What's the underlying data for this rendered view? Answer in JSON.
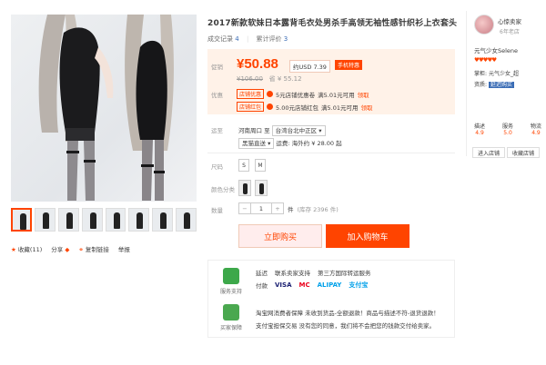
{
  "product": {
    "title": "2017新款软妹日本露背毛衣处男杀手高领无袖性感针织衫上衣套头",
    "stats": [
      {
        "label": "成交记录",
        "value": "4"
      },
      {
        "label": "累计评价",
        "value": "3"
      }
    ]
  },
  "price_box": {
    "price_label": "促销",
    "price": "¥50.88",
    "usd": "约USD 7.39",
    "mobile_badge": "手机特惠",
    "original_price": "¥106.00",
    "original_note": "省 ¥ 55.12",
    "promo_label": "优惠",
    "promos": [
      {
        "tag": "店铺优惠",
        "text": "5元店铺优惠卷",
        "detail": "满5.01元可用",
        "link": "领取"
      },
      {
        "tag": "店铺红包",
        "text": "5.00元店铺红包",
        "detail": "满5.01元可用",
        "link": "领取"
      }
    ]
  },
  "shipping": {
    "label": "运至",
    "from": "河南周口",
    "to_word": "至",
    "to": "台湾台北中正区",
    "line2": "黑猫直送",
    "line2_detail": "运费: 海外约 ¥ 28.00 起"
  },
  "sizes": {
    "label": "尺码",
    "options": [
      "S",
      "M"
    ]
  },
  "colors": {
    "label": "颜色分类"
  },
  "quantity": {
    "label": "数量",
    "value": "1",
    "unit": "件",
    "stock": "(库存 2396 件)",
    "minus": "−",
    "plus": "+"
  },
  "buttons": {
    "buy_now": "立即购买",
    "add_cart": "加入购物车"
  },
  "service": {
    "icon1_label": "服务支持",
    "line1": [
      "延迟",
      "联系卖家支持",
      "第三方国际转运服务"
    ],
    "pay_label": "付款",
    "pay_methods": [
      "VISA",
      "MC",
      "ALIPAY",
      "支付宝"
    ],
    "icon2_label": "买家保障",
    "guarantee_lines": [
      "淘宝网消费者保障   未收到货品-全额退款！商品与描述不符-退货退款！",
      "支付宝担保交易   没有您的同意，我们将不会把您的钱款交付给卖家。"
    ]
  },
  "gallery_actions": {
    "fav": "收藏(11)",
    "share": "分享",
    "copy": "复制链接",
    "report": "举报"
  },
  "shop": {
    "name": "心惊卖家",
    "age": "6年老店",
    "nickname": "元气少女Selene",
    "hearts": "♥♥♥♥♥",
    "role_label": "掌柜:",
    "role_value": "元气少女_超",
    "qual_label": "资质:",
    "qual_value": "延迟购买",
    "scores": [
      {
        "label": "描述",
        "value": "4.9"
      },
      {
        "label": "服务",
        "value": "5.0"
      },
      {
        "label": "物流",
        "value": "4.9"
      }
    ],
    "btn_enter": "进入店铺",
    "btn_collect": "收藏店铺"
  }
}
